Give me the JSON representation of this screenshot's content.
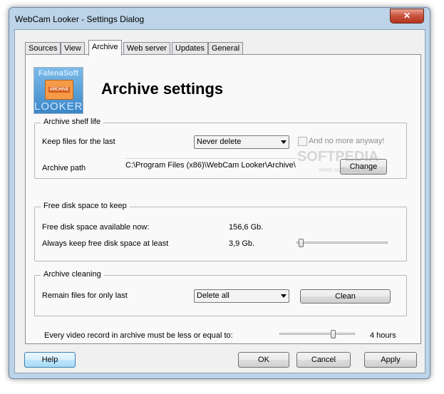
{
  "window": {
    "title": "WebCam Looker - Settings Dialog",
    "close_glyph": "✕"
  },
  "tabs": [
    {
      "label": "Sources"
    },
    {
      "label": "View"
    },
    {
      "label": "Archive",
      "active": true
    },
    {
      "label": "Web server"
    },
    {
      "label": "Updates"
    },
    {
      "label": "General"
    }
  ],
  "logo": {
    "top_text": "FalenaSoft",
    "label_text": "ARCHIVE",
    "bottom_text": "LOOKER"
  },
  "heading": "Archive settings",
  "shelf_life": {
    "legend": "Archive shelf life",
    "keep_label": "Keep files for the last",
    "keep_value": "Never delete",
    "no_more_label": "And no more anyway!",
    "no_more_checked": false,
    "path_label": "Archive path",
    "path_value": "C:\\Program Files (x86)\\WebCam Looker\\Archive\\",
    "change_label": "Change"
  },
  "disk_space": {
    "legend": "Free disk space to keep",
    "available_label": "Free disk space available now:",
    "available_value": "156,6 Gb.",
    "keep_label": "Always keep free disk space at least",
    "keep_value": "3,9 Gb.",
    "keep_slider_fraction": 0.02
  },
  "cleaning": {
    "legend": "Archive cleaning",
    "remain_label": "Remain files for only last",
    "remain_value": "Delete all",
    "clean_label": "Clean"
  },
  "record_length": {
    "label": "Every video record in archive must be less or equal to:",
    "value": "4 hours",
    "slider_fraction": 0.73
  },
  "buttons": {
    "help": "Help",
    "ok": "OK",
    "cancel": "Cancel",
    "apply": "Apply"
  },
  "watermark": {
    "main": "SOFTPEDIA",
    "sub": "www.softpedia.com"
  }
}
